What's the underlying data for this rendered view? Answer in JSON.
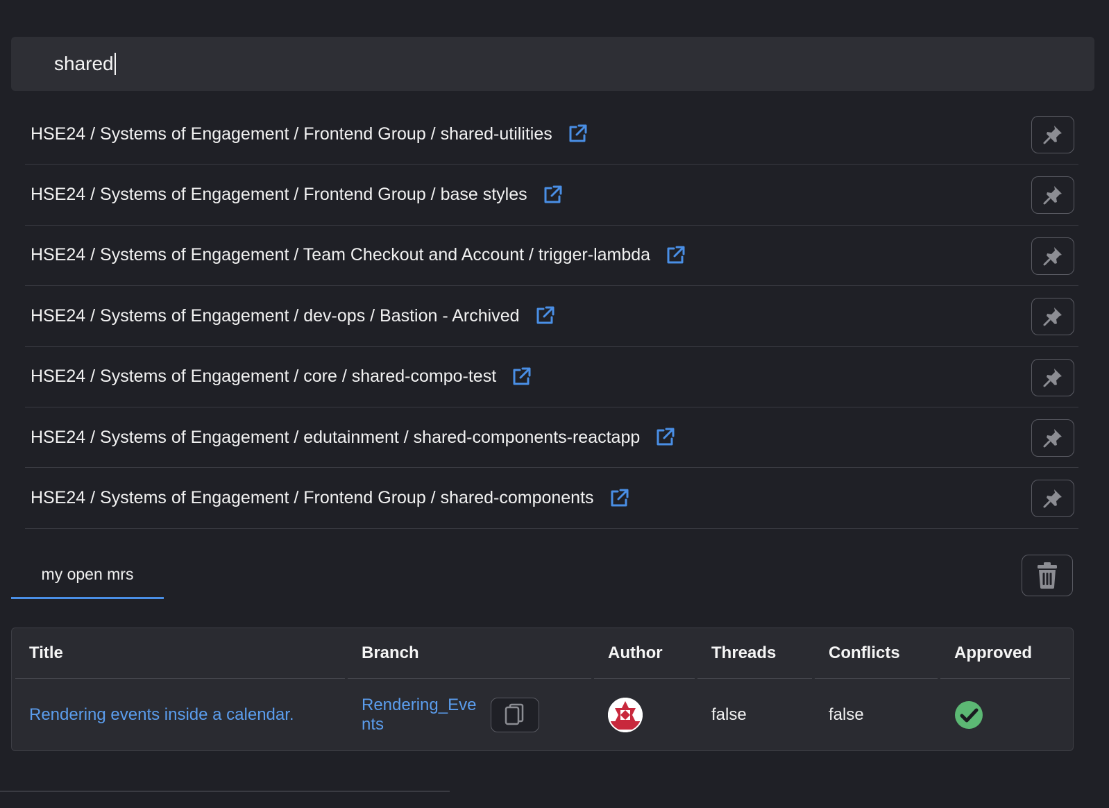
{
  "search": {
    "value": "shared"
  },
  "results": [
    {
      "label": "HSE24 / Systems of Engagement / Frontend Group / shared-utilities"
    },
    {
      "label": "HSE24 / Systems of Engagement / Frontend Group / base styles"
    },
    {
      "label": "HSE24 / Systems of Engagement / Team Checkout and Account / trigger-lambda"
    },
    {
      "label": "HSE24 / Systems of Engagement / dev-ops / Bastion - Archived"
    },
    {
      "label": "HSE24 / Systems of Engagement / core / shared-compo-test"
    },
    {
      "label": "HSE24 / Systems of Engagement / edutainment / shared-components-reactapp"
    },
    {
      "label": "HSE24 / Systems of Engagement / Frontend Group / shared-components"
    }
  ],
  "tabs": [
    {
      "label": "my open mrs",
      "active": true
    }
  ],
  "table": {
    "columns": [
      "Title",
      "Branch",
      "Author",
      "Threads",
      "Conflicts",
      "Approved"
    ],
    "rows": [
      {
        "title": "Rendering events inside a calendar.",
        "branch": "Rendering_Events",
        "author_icon": "avatar-icon",
        "threads": "false",
        "conflicts": "false",
        "approved_icon": "check-circle-icon"
      }
    ]
  },
  "colors": {
    "background": "#1f2026",
    "link": "#5b9ded",
    "accent": "#4a8fe6",
    "approved": "#5cb874"
  }
}
